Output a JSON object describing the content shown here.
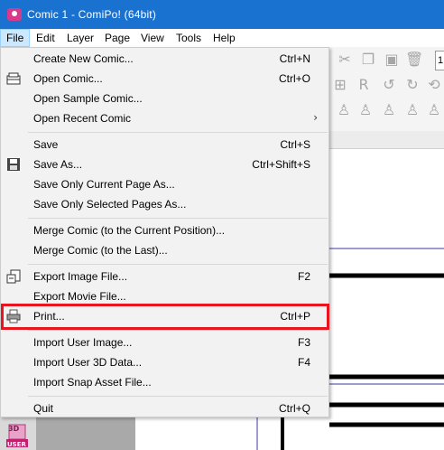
{
  "window": {
    "title": "Comic 1 - ComiPo! (64bit)"
  },
  "menubar": [
    "File",
    "Edit",
    "Layer",
    "Page",
    "View",
    "Tools",
    "Help"
  ],
  "file_menu": {
    "items": [
      {
        "label": "Create New Comic...",
        "shortcut": "Ctrl+N"
      },
      {
        "label": "Open Comic...",
        "shortcut": "Ctrl+O",
        "icon": "open-icon"
      },
      {
        "label": "Open Sample Comic...",
        "shortcut": ""
      },
      {
        "label": "Open Recent Comic",
        "shortcut": "",
        "submenu": true
      },
      {
        "label": "Save",
        "shortcut": "Ctrl+S"
      },
      {
        "label": "Save As...",
        "shortcut": "Ctrl+Shift+S",
        "icon": "save-icon"
      },
      {
        "label": "Save Only Current Page As...",
        "shortcut": ""
      },
      {
        "label": "Save Only Selected Pages As...",
        "shortcut": ""
      },
      {
        "label": "Merge Comic (to the Current Position)...",
        "shortcut": ""
      },
      {
        "label": "Merge Comic (to the Last)...",
        "shortcut": ""
      },
      {
        "label": "Export Image File...",
        "shortcut": "F2",
        "icon": "export-image-icon"
      },
      {
        "label": "Export Movie File...",
        "shortcut": ""
      },
      {
        "label": "Print...",
        "shortcut": "Ctrl+P",
        "icon": "printer-icon",
        "highlighted": true
      },
      {
        "label": "Import User Image...",
        "shortcut": "F3"
      },
      {
        "label": "Import User 3D Data...",
        "shortcut": "F4"
      },
      {
        "label": "Import Snap Asset File...",
        "shortcut": ""
      },
      {
        "label": "Quit",
        "shortcut": "Ctrl+Q"
      }
    ]
  },
  "toolbar": {
    "zoom_value": "1."
  },
  "user_badge": {
    "top_text": "3D",
    "bottom_text": "USER"
  },
  "colors": {
    "title_bar": "#1a72d0",
    "highlight_border": "#e8141e",
    "menu_bg": "#f2f2f2"
  }
}
